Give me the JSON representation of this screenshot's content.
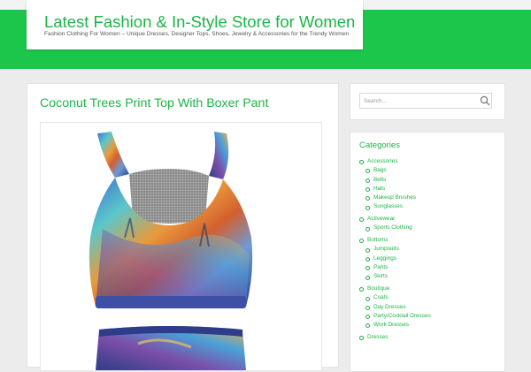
{
  "header": {
    "site_title": "Latest Fashion & In-Style Store for Women",
    "tagline": "Fashion Clothing For Women – Unique Dresses, Designer Tops, Shoes, Jewelry & Accessories for the Trendy Women",
    "accent_color": "#1cc64a"
  },
  "post": {
    "title": "Coconut Trees Print Top With Boxer Pant",
    "image_alt": "Coconut trees tropical print sports top with boxer pant"
  },
  "search": {
    "placeholder": "Search...",
    "icon": "search-icon"
  },
  "categories": {
    "title": "Categories",
    "items": [
      {
        "label": "Accessories",
        "children": [
          "Bags",
          "Belts",
          "Hats",
          "Makeup Brushes",
          "Sunglasses"
        ]
      },
      {
        "label": "Activewear",
        "children": [
          "Sports Clothing"
        ]
      },
      {
        "label": "Bottoms",
        "children": [
          "Jumpsuits",
          "Leggings",
          "Pants",
          "Skirts"
        ]
      },
      {
        "label": "Boutique",
        "children": [
          "Coats",
          "Day Dresses",
          "Party/Cocktail Dresses",
          "Work Dresses"
        ]
      },
      {
        "label": "Dresses",
        "children": []
      }
    ]
  }
}
